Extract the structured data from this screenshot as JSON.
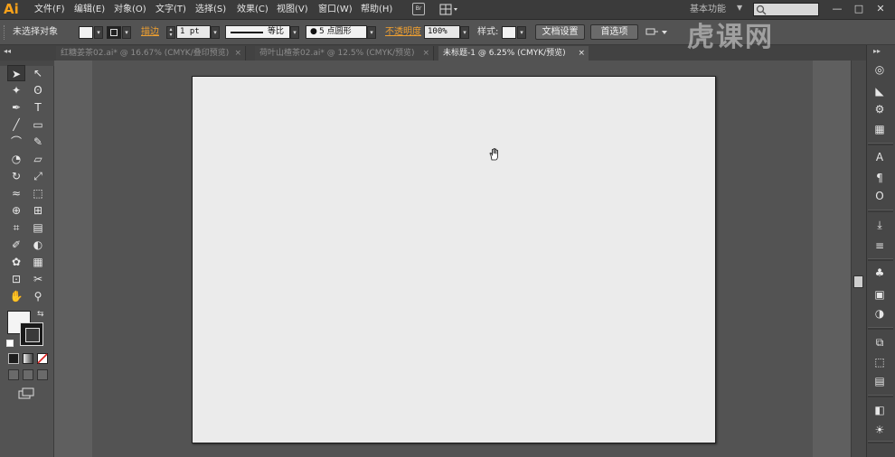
{
  "app": {
    "logo": "Ai"
  },
  "menu": {
    "items": [
      "文件(F)",
      "编辑(E)",
      "对象(O)",
      "文字(T)",
      "选择(S)",
      "效果(C)",
      "视图(V)",
      "窗口(W)",
      "帮助(H)"
    ],
    "bridge_label": "Br",
    "workspace": "基本功能",
    "search_placeholder": ""
  },
  "window_controls": {
    "minimize": "—",
    "restore": "□",
    "close": "✕"
  },
  "control_bar": {
    "selection_status": "未选择对象",
    "stroke_label": "描边",
    "stroke_weight": "1 pt",
    "profile_label": "等比",
    "brush_label": "5 点圆形",
    "opacity_label": "不透明度",
    "opacity_value": "100%",
    "style_label": "样式:",
    "doc_setup_button": "文档设置",
    "preferences_button": "首选项"
  },
  "tabs": [
    {
      "label": "红糖姜茶02.ai* @ 16.67% (CMYK/叠印预览)",
      "active": false
    },
    {
      "label": "荷叶山楂茶02.ai* @ 12.5% (CMYK/预览)",
      "active": false
    },
    {
      "label": "未标题-1 @ 6.25% (CMYK/预览)",
      "active": true
    }
  ],
  "tab_close_glyph": "×",
  "collapse_glyph": "◂◂",
  "tools": [
    "selection-icon",
    "direct-selection-icon",
    "magic-wand-icon",
    "lasso-icon",
    "pen-icon",
    "type-icon",
    "line-icon",
    "rectangle-icon",
    "paintbrush-icon",
    "pencil-icon",
    "blob-brush-icon",
    "eraser-icon",
    "rotate-icon",
    "scale-icon",
    "warp-icon",
    "free-transform-icon",
    "shape-builder-icon",
    "perspective-grid-icon",
    "mesh-icon",
    "gradient-icon",
    "eyedropper-icon",
    "blend-icon",
    "symbol-sprayer-icon",
    "column-graph-icon",
    "artboard-icon",
    "slice-icon",
    "hand-icon",
    "zoom-icon"
  ],
  "colors": {
    "fill": "#f4f4f4",
    "stroke": "#1a1a1a",
    "artboard": "#ebebeb",
    "accent": "#f7a11a",
    "orange_label": "#f0a030"
  },
  "watermark": "虎课网"
}
